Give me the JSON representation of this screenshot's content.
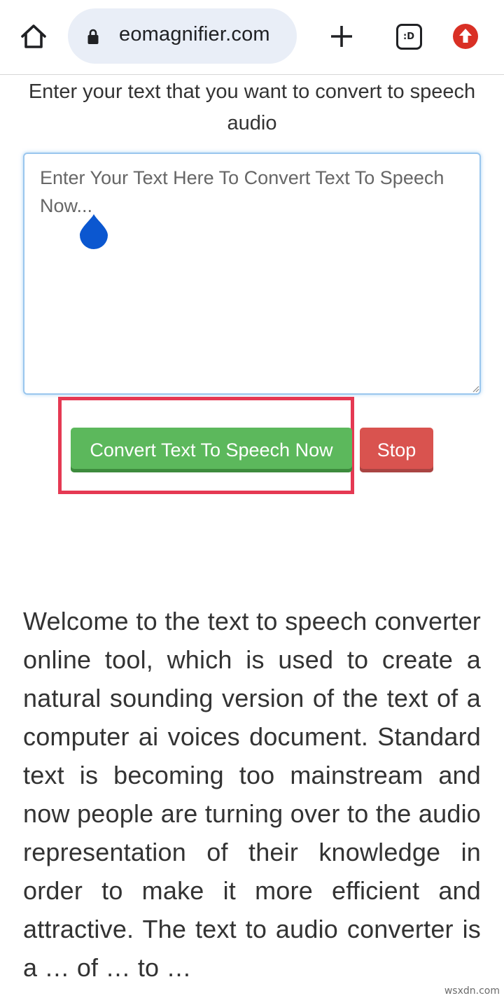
{
  "browser": {
    "url": "eomagnifier.com",
    "tab_count_label": ":D",
    "icons": {
      "home": "home-icon",
      "lock": "lock-icon",
      "new_tab": "plus-icon",
      "tabs": "tab-switcher-icon",
      "update": "update-arrow-icon"
    },
    "update_color": "#d93025"
  },
  "page": {
    "intro": "Enter your text that you want to convert to speech audio",
    "textarea_placeholder": "Enter Your Text Here To Convert Text To Speech Now...",
    "convert_button": "Convert Text To Speech Now",
    "stop_button": "Stop",
    "welcome_text": "Welcome to the text to speech converter online tool, which is used to create a natural sounding version of the text of a computer ai voices document. Standard text is becoming too mainstream and now people are turning over to the audio representation of their knowledge in order to make it more efficient and attractive. The text to audio converter is a … of … to … "
  },
  "colors": {
    "convert": "#5cb85c",
    "stop": "#d9534f",
    "highlight": "#e53953",
    "cursor_handle": "#0b57d0"
  },
  "watermark": "wsxdn.com"
}
